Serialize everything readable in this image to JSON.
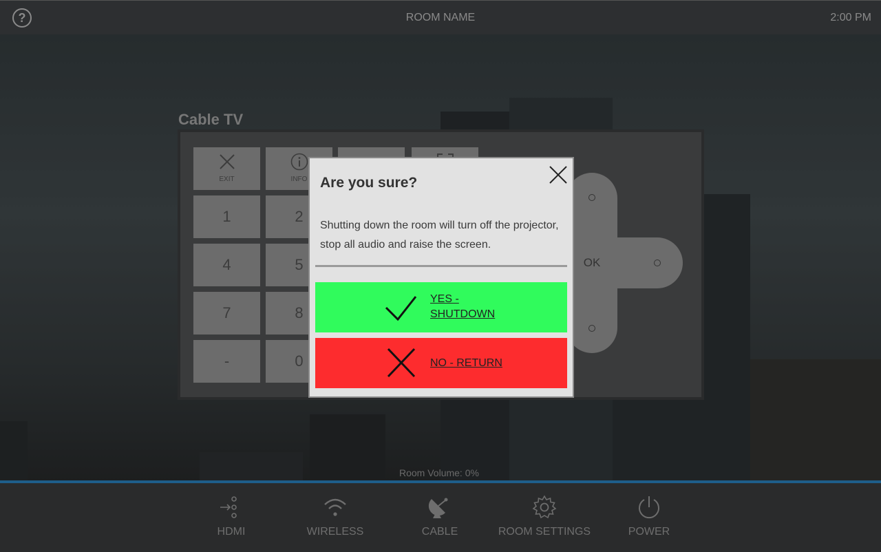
{
  "header": {
    "help_label": "?",
    "room_name": "ROOM NAME",
    "time": "2:00 PM"
  },
  "panel": {
    "title": "Cable TV",
    "keys": [
      {
        "label": "EXIT",
        "icon": "close-icon"
      },
      {
        "label": "INFO",
        "icon": "info-icon"
      },
      {
        "label": "",
        "icon": "menu-icon"
      },
      {
        "label": "",
        "icon": "fullscreen-icon"
      }
    ],
    "numbers": [
      "1",
      "2",
      "4",
      "5",
      "7",
      "8",
      "-",
      "0"
    ],
    "ok_label": "OK"
  },
  "dialog": {
    "title": "Are you sure?",
    "message": "Shutting down the room will turn off the projector, stop all audio and raise the screen.",
    "yes_line1": "YES -",
    "yes_line2": "SHUTDOWN",
    "no_label": "NO - RETURN",
    "colors": {
      "yes": "#30fb5c",
      "no": "#fd2c2e"
    }
  },
  "volume": {
    "label": "Room Volume: 0%",
    "level": 0
  },
  "nav": {
    "items": [
      {
        "label": "HDMI",
        "icon": "hdmi-icon"
      },
      {
        "label": "WIRELESS",
        "icon": "wifi-icon"
      },
      {
        "label": "CABLE",
        "icon": "satellite-dish-icon"
      },
      {
        "label": "ROOM SETTINGS",
        "icon": "gear-icon"
      },
      {
        "label": "POWER",
        "icon": "power-icon"
      }
    ]
  }
}
